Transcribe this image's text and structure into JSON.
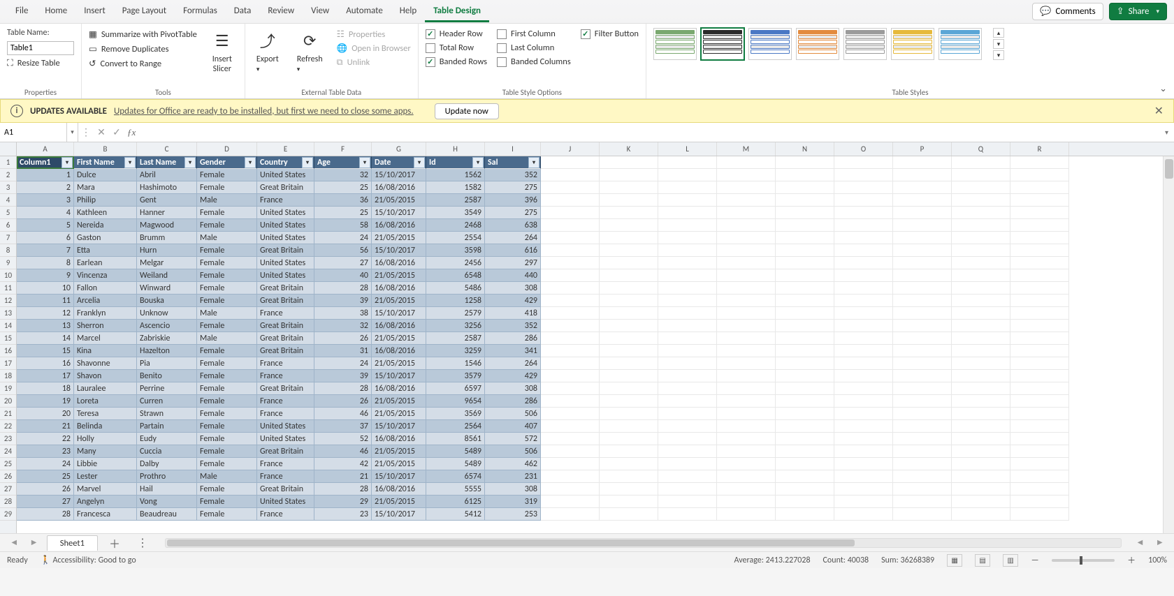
{
  "tabs": {
    "items": [
      "File",
      "Home",
      "Insert",
      "Page Layout",
      "Formulas",
      "Data",
      "Review",
      "View",
      "Automate",
      "Help",
      "Table Design"
    ],
    "active": "Table Design",
    "comments": "Comments",
    "share": "Share"
  },
  "ribbon": {
    "properties": {
      "label": "Properties",
      "table_name_label": "Table Name:",
      "table_name_value": "Table1",
      "resize": "Resize Table"
    },
    "tools": {
      "label": "Tools",
      "summarize": "Summarize with PivotTable",
      "remove_dup": "Remove Duplicates",
      "convert": "Convert to Range",
      "slicer": "Insert\nSlicer"
    },
    "ext": {
      "label": "External Table Data",
      "export": "Export",
      "refresh": "Refresh",
      "properties": "Properties",
      "open_browser": "Open in Browser",
      "unlink": "Unlink"
    },
    "opts": {
      "label": "Table Style Options",
      "header_row": "Header Row",
      "total_row": "Total Row",
      "banded_rows": "Banded Rows",
      "first_col": "First Column",
      "last_col": "Last Column",
      "banded_cols": "Banded Columns",
      "filter": "Filter Button"
    },
    "styles": {
      "label": "Table Styles",
      "accents": [
        "#7aa86f",
        "#2b2b2b",
        "#4a78c4",
        "#e38b3e",
        "#9b9b9b",
        "#e6b93b",
        "#5aa6d6"
      ]
    }
  },
  "infobar": {
    "title": "UPDATES AVAILABLE",
    "message": "Updates for Office are ready to be installed, but first we need to close some apps.",
    "button": "Update now"
  },
  "namebox": "A1",
  "columns": {
    "letters": [
      "A",
      "B",
      "C",
      "D",
      "E",
      "F",
      "G",
      "H",
      "I",
      "J",
      "K",
      "L",
      "M",
      "N",
      "O",
      "P",
      "Q",
      "R"
    ],
    "widths": [
      82,
      90,
      86,
      86,
      82,
      82,
      78,
      84,
      80,
      84,
      84,
      84,
      84,
      84,
      84,
      84,
      84,
      84
    ]
  },
  "table": {
    "headers": [
      "Column1",
      "First Name",
      "Last Name",
      "Gender",
      "Country",
      "Age",
      "Date",
      "Id",
      "Sal"
    ],
    "rows": [
      [
        1,
        "Dulce",
        "Abril",
        "Female",
        "United States",
        32,
        "15/10/2017",
        1562,
        352
      ],
      [
        2,
        "Mara",
        "Hashimoto",
        "Female",
        "Great Britain",
        25,
        "16/08/2016",
        1582,
        275
      ],
      [
        3,
        "Philip",
        "Gent",
        "Male",
        "France",
        36,
        "21/05/2015",
        2587,
        396
      ],
      [
        4,
        "Kathleen",
        "Hanner",
        "Female",
        "United States",
        25,
        "15/10/2017",
        3549,
        275
      ],
      [
        5,
        "Nereida",
        "Magwood",
        "Female",
        "United States",
        58,
        "16/08/2016",
        2468,
        638
      ],
      [
        6,
        "Gaston",
        "Brumm",
        "Male",
        "United States",
        24,
        "21/05/2015",
        2554,
        264
      ],
      [
        7,
        "Etta",
        "Hurn",
        "Female",
        "Great Britain",
        56,
        "15/10/2017",
        3598,
        616
      ],
      [
        8,
        "Earlean",
        "Melgar",
        "Female",
        "United States",
        27,
        "16/08/2016",
        2456,
        297
      ],
      [
        9,
        "Vincenza",
        "Weiland",
        "Female",
        "United States",
        40,
        "21/05/2015",
        6548,
        440
      ],
      [
        10,
        "Fallon",
        "Winward",
        "Female",
        "Great Britain",
        28,
        "16/08/2016",
        5486,
        308
      ],
      [
        11,
        "Arcelia",
        "Bouska",
        "Female",
        "Great Britain",
        39,
        "21/05/2015",
        1258,
        429
      ],
      [
        12,
        "Franklyn",
        "Unknow",
        "Male",
        "France",
        38,
        "15/10/2017",
        2579,
        418
      ],
      [
        13,
        "Sherron",
        "Ascencio",
        "Female",
        "Great Britain",
        32,
        "16/08/2016",
        3256,
        352
      ],
      [
        14,
        "Marcel",
        "Zabriskie",
        "Male",
        "Great Britain",
        26,
        "21/05/2015",
        2587,
        286
      ],
      [
        15,
        "Kina",
        "Hazelton",
        "Female",
        "Great Britain",
        31,
        "16/08/2016",
        3259,
        341
      ],
      [
        16,
        "Shavonne",
        "Pia",
        "Female",
        "France",
        24,
        "21/05/2015",
        1546,
        264
      ],
      [
        17,
        "Shavon",
        "Benito",
        "Female",
        "France",
        39,
        "15/10/2017",
        3579,
        429
      ],
      [
        18,
        "Lauralee",
        "Perrine",
        "Female",
        "Great Britain",
        28,
        "16/08/2016",
        6597,
        308
      ],
      [
        19,
        "Loreta",
        "Curren",
        "Female",
        "France",
        26,
        "21/05/2015",
        9654,
        286
      ],
      [
        20,
        "Teresa",
        "Strawn",
        "Female",
        "France",
        46,
        "21/05/2015",
        3569,
        506
      ],
      [
        21,
        "Belinda",
        "Partain",
        "Female",
        "United States",
        37,
        "15/10/2017",
        2564,
        407
      ],
      [
        22,
        "Holly",
        "Eudy",
        "Female",
        "United States",
        52,
        "16/08/2016",
        8561,
        572
      ],
      [
        23,
        "Many",
        "Cuccia",
        "Female",
        "Great Britain",
        46,
        "21/05/2015",
        5489,
        506
      ],
      [
        24,
        "Libbie",
        "Dalby",
        "Female",
        "France",
        42,
        "21/05/2015",
        5489,
        462
      ],
      [
        25,
        "Lester",
        "Prothro",
        "Male",
        "France",
        21,
        "15/10/2017",
        6574,
        231
      ],
      [
        26,
        "Marvel",
        "Hail",
        "Female",
        "Great Britain",
        28,
        "16/08/2016",
        5555,
        308
      ],
      [
        27,
        "Angelyn",
        "Vong",
        "Female",
        "United States",
        29,
        "21/05/2015",
        6125,
        319
      ],
      [
        28,
        "Francesca",
        "Beaudreau",
        "Female",
        "France",
        23,
        "15/10/2017",
        5412,
        253
      ]
    ],
    "numeric_cols": [
      0,
      5,
      7,
      8
    ]
  },
  "sheet": {
    "name": "Sheet1"
  },
  "status": {
    "ready": "Ready",
    "access": "Accessibility: Good to go",
    "average_label": "Average:",
    "average": "2413.227028",
    "count_label": "Count:",
    "count": "40038",
    "sum_label": "Sum:",
    "sum": "36268389",
    "zoom": "100%"
  }
}
